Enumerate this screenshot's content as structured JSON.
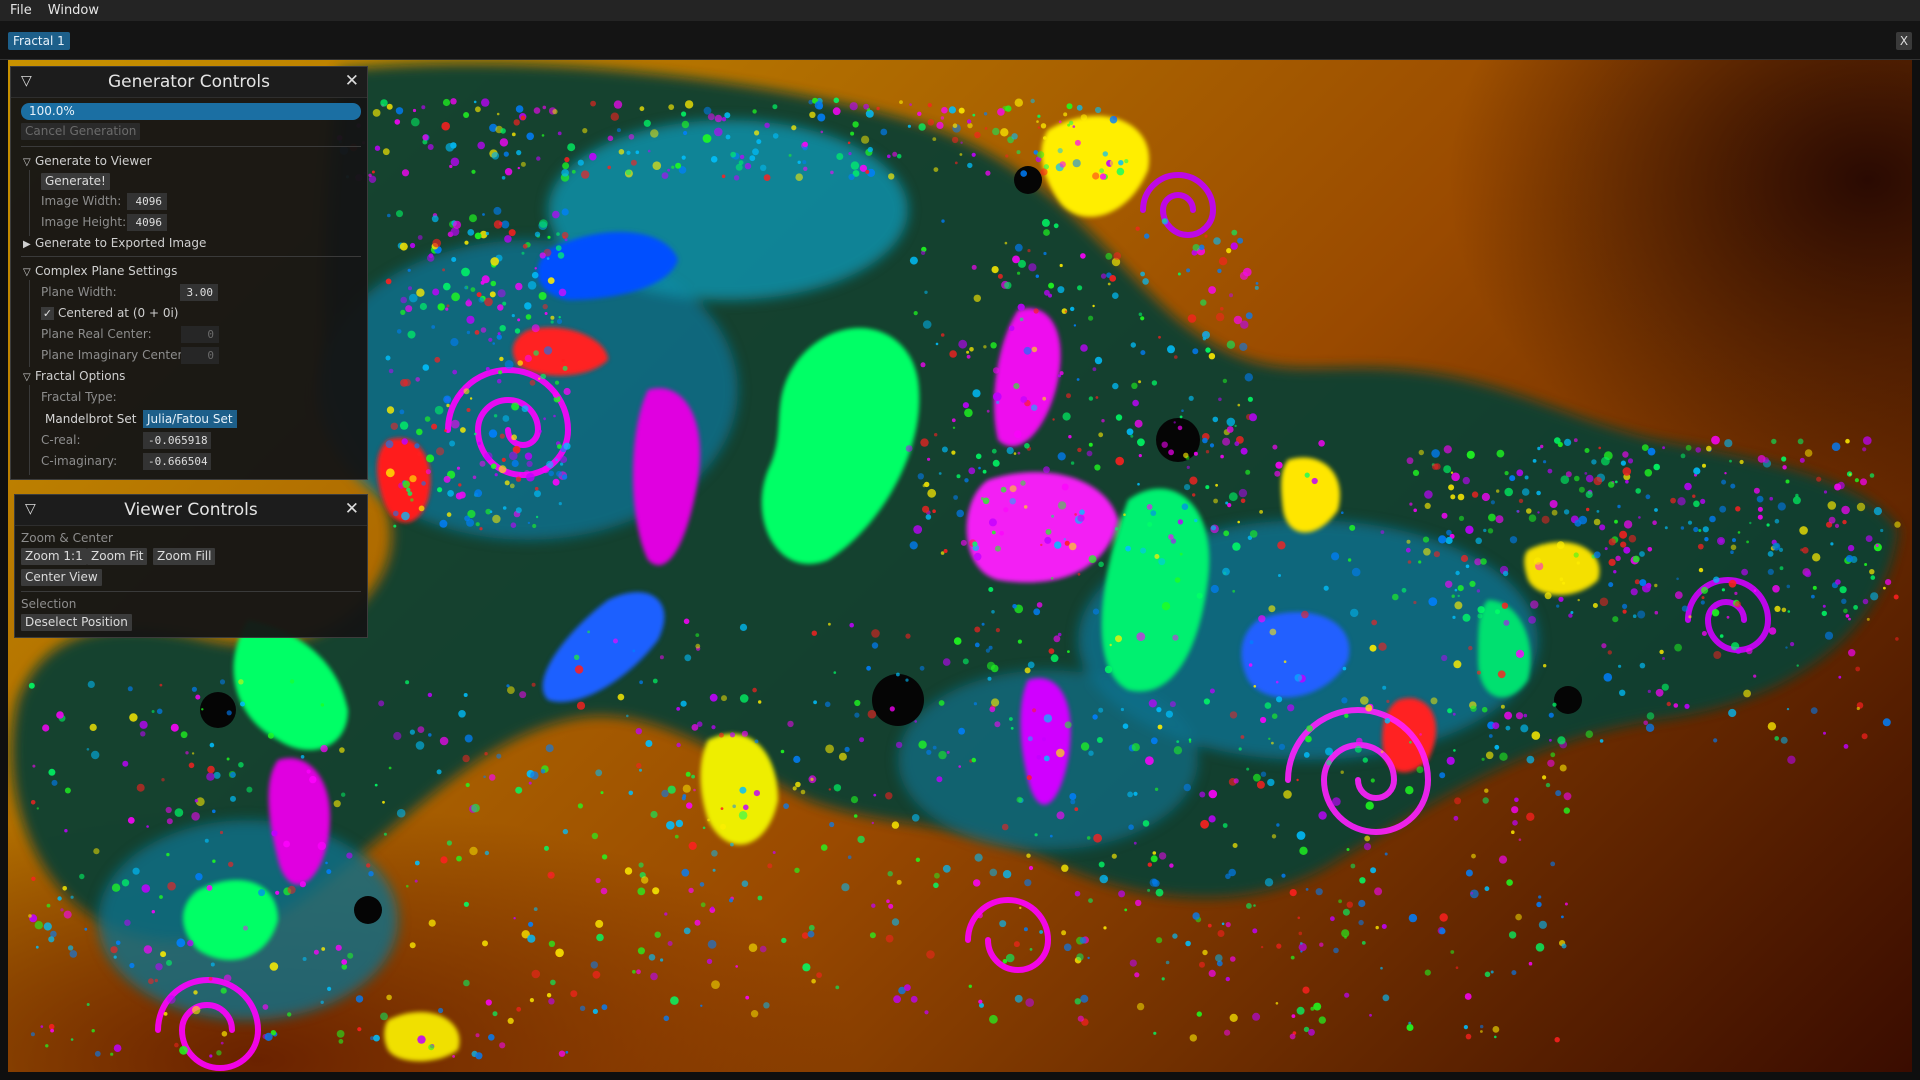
{
  "menu": {
    "file": "File",
    "window": "Window"
  },
  "tabs": {
    "active": "Fractal 1",
    "close": "X"
  },
  "generator": {
    "title": "Generator Controls",
    "progress_value": 1.0,
    "progress_text": "100.0%",
    "cancel_label": "Cancel Generation",
    "gen_viewer": {
      "header": "Generate to Viewer",
      "generate_label": "Generate!",
      "width_label": "Image Width:",
      "width_value": "4096",
      "height_label": "Image Height:",
      "height_value": "4096"
    },
    "gen_export_header": "Generate to Exported Image",
    "plane": {
      "header": "Complex Plane Settings",
      "width_label": "Plane Width:",
      "width_value": "3.00",
      "centered_label": "Centered at (0 + 0i)",
      "centered_checked": true,
      "real_label": "Plane Real Center:",
      "real_value": "0",
      "imag_label": "Plane Imaginary Center:",
      "imag_value": "0"
    },
    "fractal": {
      "header": "Fractal Options",
      "type_label": "Fractal Type:",
      "mandelbrot": "Mandelbrot Set",
      "julia": "Julia/Fatou Set",
      "selected": "Julia/Fatou Set",
      "creal_label": "C-real:",
      "creal_value": "-0.065918",
      "cimag_label": "C-imaginary:",
      "cimag_value": "-0.666504"
    }
  },
  "viewer": {
    "title": "Viewer Controls",
    "zoom_header": "Zoom & Center",
    "zoom11": "Zoom 1:1",
    "zoom_fit": "Zoom Fit",
    "zoom_fill": "Zoom Fill",
    "center_view": "Center View",
    "selection_header": "Selection",
    "deselect": "Deselect Position"
  },
  "icons": {
    "collapse": "triangle-down-icon",
    "expand": "triangle-right-icon",
    "close": "close-icon",
    "check": "checkmark-icon"
  },
  "colors": {
    "accent": "#1d5f8a",
    "progress": "#1b6fa3",
    "panel_bg": "#151515",
    "fractal_palette": [
      "#ff00ff",
      "#00ff66",
      "#0080ff",
      "#ffee00",
      "#ff2020",
      "#00c0ff",
      "#c000ff",
      "#20ff20"
    ]
  }
}
